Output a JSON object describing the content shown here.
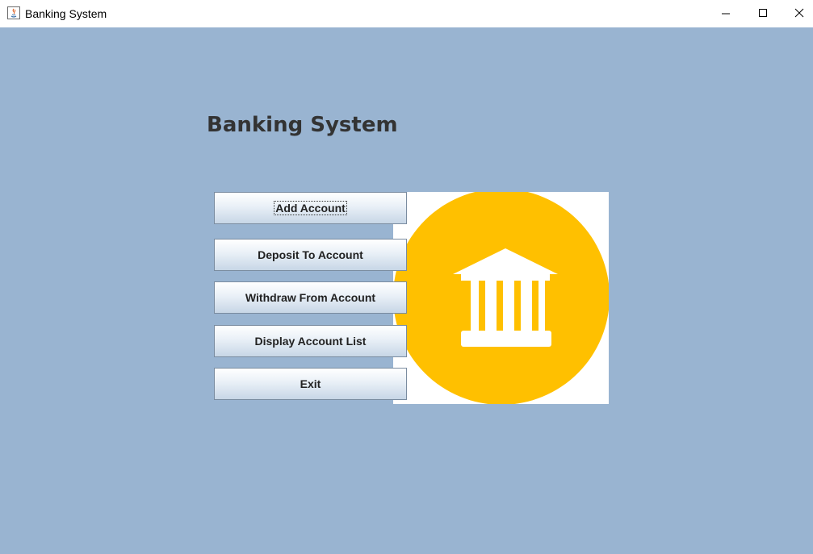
{
  "window": {
    "title": "Banking System",
    "controls": {
      "minimize": "—",
      "maximize": "☐",
      "close": "✕"
    }
  },
  "main": {
    "heading": "Banking System",
    "image_icon": "bank-building-icon",
    "buttons": [
      {
        "label": "Add Account",
        "focused": true
      },
      {
        "label": "Deposit To Account",
        "focused": false
      },
      {
        "label": "Withdraw From Account",
        "focused": false
      },
      {
        "label": "Display Account List",
        "focused": false
      },
      {
        "label": "Exit",
        "focused": false
      }
    ]
  },
  "colors": {
    "background": "#99b4d1",
    "heading": "#333333",
    "coin": "#ffc000",
    "image_bg": "#ffffff"
  }
}
